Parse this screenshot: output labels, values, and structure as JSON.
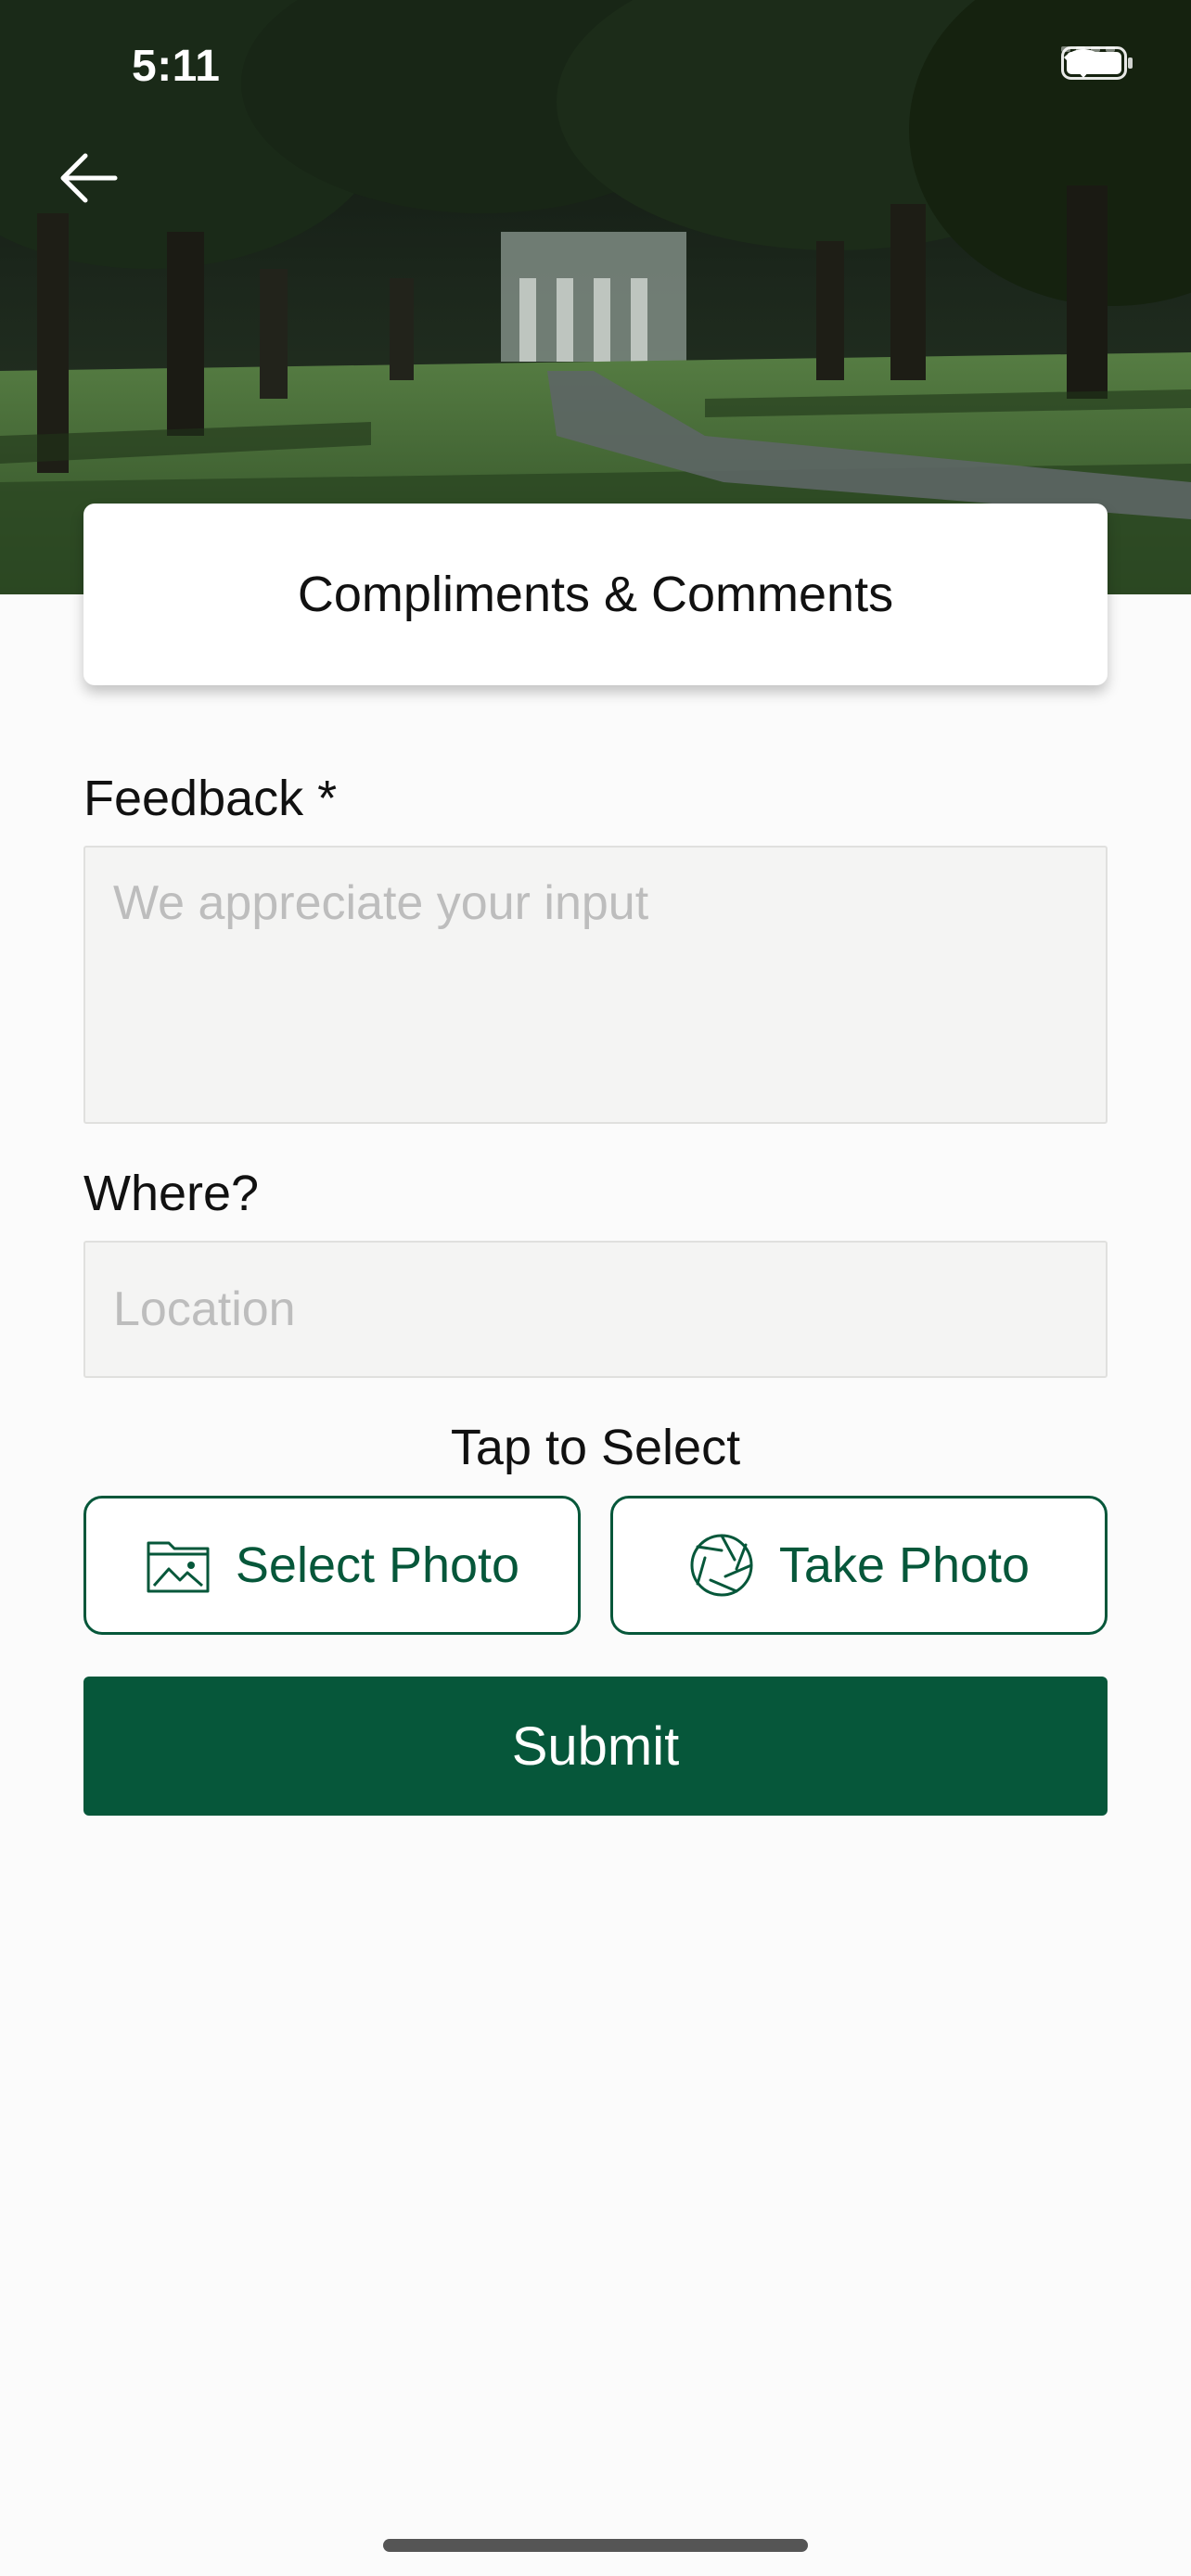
{
  "status_bar": {
    "time": "5:11"
  },
  "header": {
    "title": "Compliments & Comments"
  },
  "form": {
    "feedback_label": "Feedback *",
    "feedback_placeholder": "We appreciate your input",
    "location_label": "Where?",
    "location_placeholder": "Location",
    "tap_to_select": "Tap to Select",
    "select_photo_label": "Select Photo",
    "take_photo_label": "Take Photo",
    "submit_label": "Submit"
  },
  "icons": {
    "back": "arrow-left-icon",
    "select_photo": "image-folder-icon",
    "take_photo": "camera-aperture-icon",
    "wifi": "wifi-icon",
    "battery": "battery-icon"
  },
  "colors": {
    "brand_green": "#06573a",
    "background": "#fbfbfb",
    "input_bg": "#f4f4f3",
    "placeholder": "#bdbdbd"
  }
}
